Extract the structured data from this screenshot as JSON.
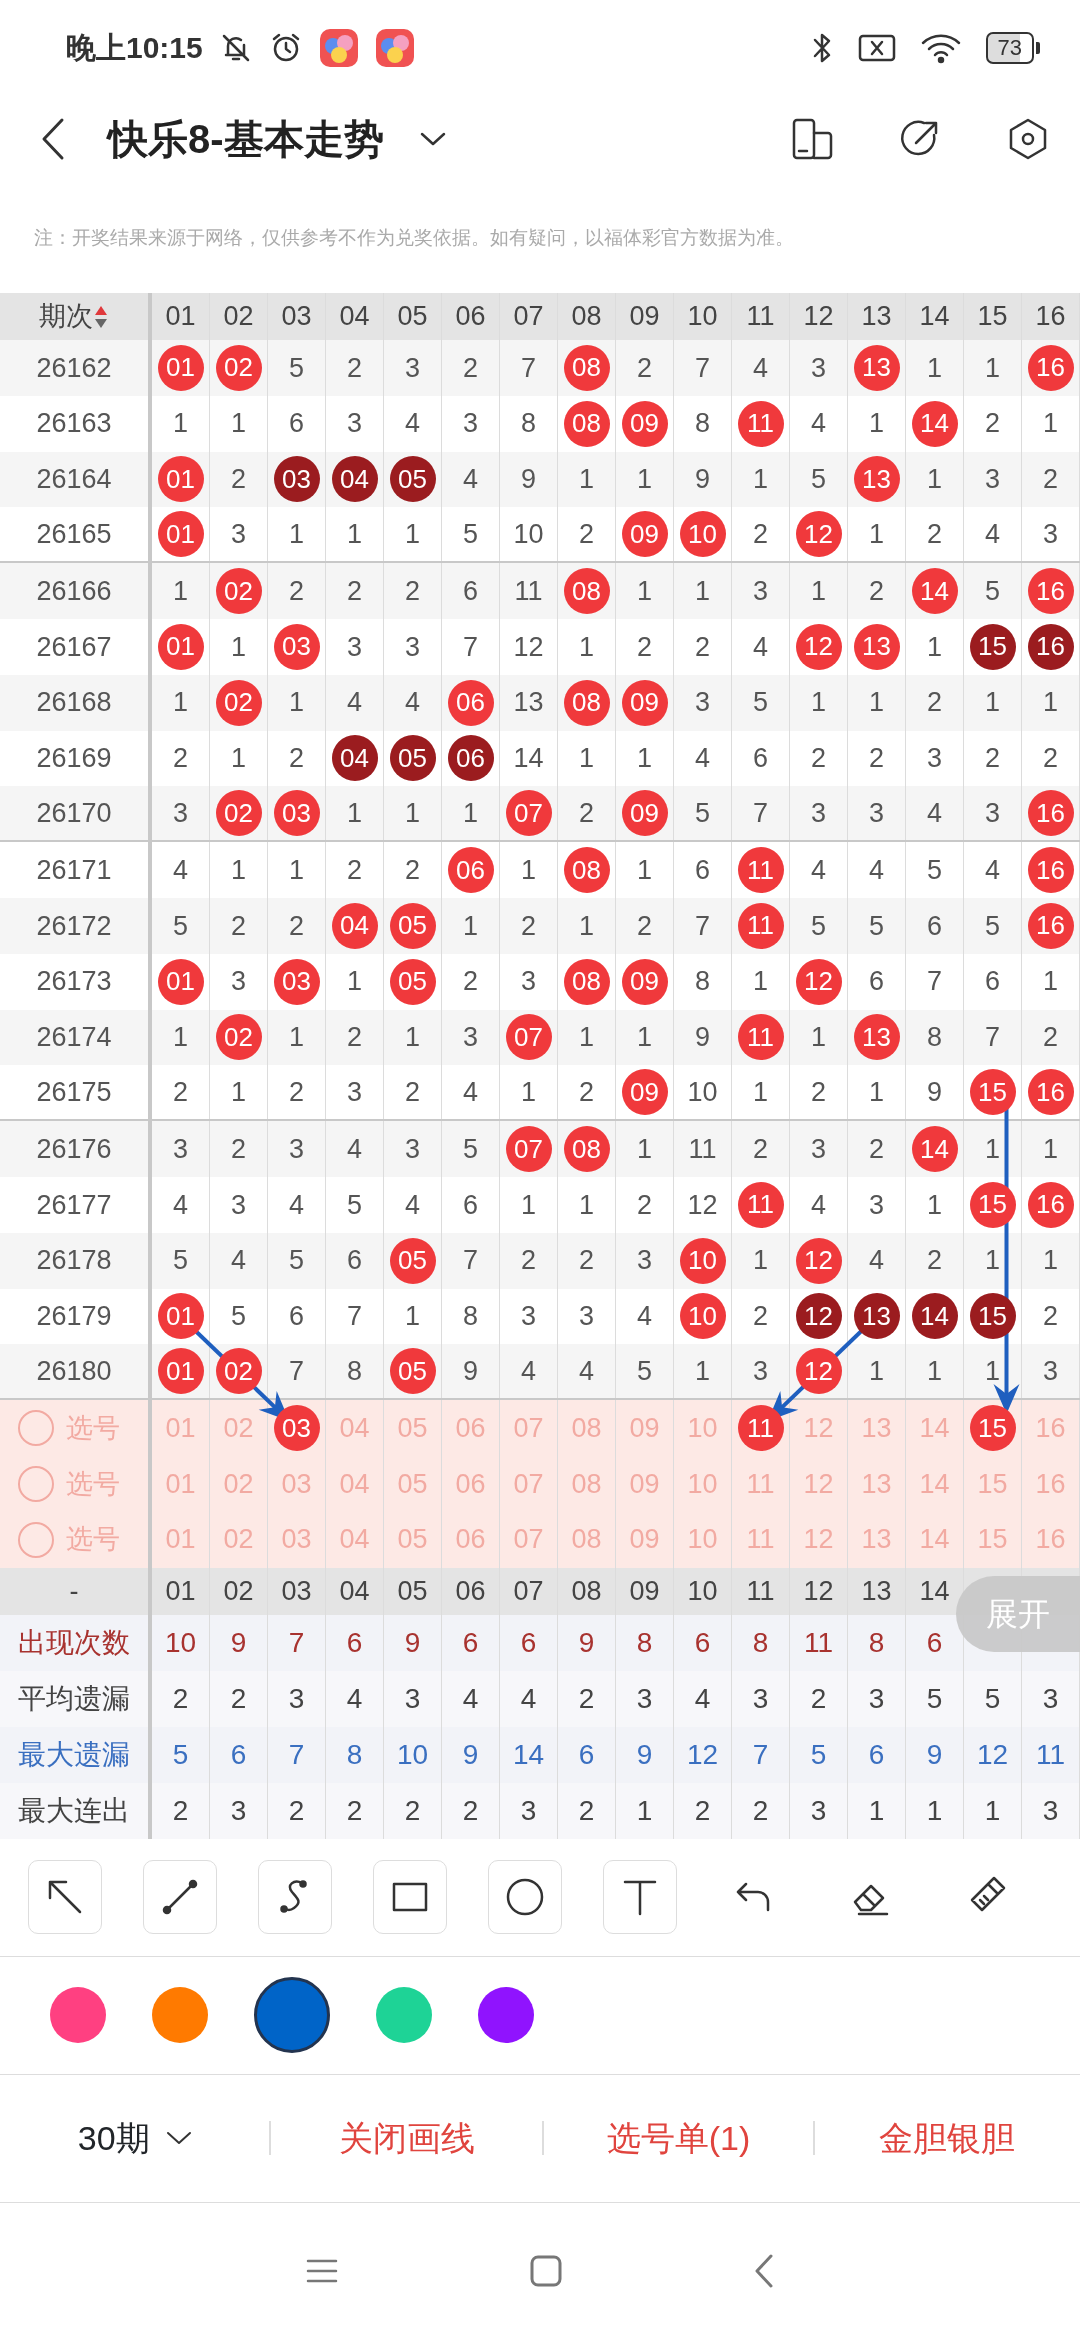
{
  "status_bar": {
    "time": "晚上10:15",
    "battery": "73"
  },
  "header": {
    "title": "快乐8-基本走势"
  },
  "notice": "注：开奖结果来源于网络，仅供参考不作为兑奖依据。如有疑问，以福体彩官方数据为准。",
  "table": {
    "period_label": "期次",
    "columns": [
      "01",
      "02",
      "03",
      "04",
      "05",
      "06",
      "07",
      "08",
      "09",
      "10",
      "11",
      "12",
      "13",
      "14",
      "15",
      "16"
    ],
    "rows": [
      {
        "period": "26162",
        "cells": [
          {
            "text": "01",
            "kind": "hit"
          },
          {
            "text": "02",
            "kind": "hit"
          },
          {
            "text": "5",
            "kind": "miss"
          },
          {
            "text": "2",
            "kind": "miss"
          },
          {
            "text": "3",
            "kind": "miss"
          },
          {
            "text": "2",
            "kind": "miss"
          },
          {
            "text": "7",
            "kind": "miss"
          },
          {
            "text": "08",
            "kind": "hit"
          },
          {
            "text": "2",
            "kind": "miss"
          },
          {
            "text": "7",
            "kind": "miss"
          },
          {
            "text": "4",
            "kind": "miss"
          },
          {
            "text": "3",
            "kind": "miss"
          },
          {
            "text": "13",
            "kind": "hit"
          },
          {
            "text": "1",
            "kind": "miss"
          },
          {
            "text": "1",
            "kind": "miss"
          },
          {
            "text": "16",
            "kind": "hit"
          }
        ]
      },
      {
        "period": "26163",
        "cells": [
          {
            "text": "1",
            "kind": "miss"
          },
          {
            "text": "1",
            "kind": "miss"
          },
          {
            "text": "6",
            "kind": "miss"
          },
          {
            "text": "3",
            "kind": "miss"
          },
          {
            "text": "4",
            "kind": "miss"
          },
          {
            "text": "3",
            "kind": "miss"
          },
          {
            "text": "8",
            "kind": "miss"
          },
          {
            "text": "08",
            "kind": "hit"
          },
          {
            "text": "09",
            "kind": "hit"
          },
          {
            "text": "8",
            "kind": "miss"
          },
          {
            "text": "11",
            "kind": "hit"
          },
          {
            "text": "4",
            "kind": "miss"
          },
          {
            "text": "1",
            "kind": "miss"
          },
          {
            "text": "14",
            "kind": "hit"
          },
          {
            "text": "2",
            "kind": "miss"
          },
          {
            "text": "1",
            "kind": "miss"
          }
        ]
      },
      {
        "period": "26164",
        "cells": [
          {
            "text": "01",
            "kind": "hit"
          },
          {
            "text": "2",
            "kind": "miss"
          },
          {
            "text": "03",
            "kind": "run"
          },
          {
            "text": "04",
            "kind": "run"
          },
          {
            "text": "05",
            "kind": "run"
          },
          {
            "text": "4",
            "kind": "miss"
          },
          {
            "text": "9",
            "kind": "miss"
          },
          {
            "text": "1",
            "kind": "miss"
          },
          {
            "text": "1",
            "kind": "miss"
          },
          {
            "text": "9",
            "kind": "miss"
          },
          {
            "text": "1",
            "kind": "miss"
          },
          {
            "text": "5",
            "kind": "miss"
          },
          {
            "text": "13",
            "kind": "hit"
          },
          {
            "text": "1",
            "kind": "miss"
          },
          {
            "text": "3",
            "kind": "miss"
          },
          {
            "text": "2",
            "kind": "miss"
          }
        ]
      },
      {
        "period": "26165",
        "cells": [
          {
            "text": "01",
            "kind": "hit"
          },
          {
            "text": "3",
            "kind": "miss"
          },
          {
            "text": "1",
            "kind": "miss"
          },
          {
            "text": "1",
            "kind": "miss"
          },
          {
            "text": "1",
            "kind": "miss"
          },
          {
            "text": "5",
            "kind": "miss"
          },
          {
            "text": "10",
            "kind": "miss"
          },
          {
            "text": "2",
            "kind": "miss"
          },
          {
            "text": "09",
            "kind": "hit"
          },
          {
            "text": "10",
            "kind": "hit"
          },
          {
            "text": "2",
            "kind": "miss"
          },
          {
            "text": "12",
            "kind": "hit"
          },
          {
            "text": "1",
            "kind": "miss"
          },
          {
            "text": "2",
            "kind": "miss"
          },
          {
            "text": "4",
            "kind": "miss"
          },
          {
            "text": "3",
            "kind": "miss"
          }
        ]
      },
      {
        "period": "26166",
        "cells": [
          {
            "text": "1",
            "kind": "miss"
          },
          {
            "text": "02",
            "kind": "hit"
          },
          {
            "text": "2",
            "kind": "miss"
          },
          {
            "text": "2",
            "kind": "miss"
          },
          {
            "text": "2",
            "kind": "miss"
          },
          {
            "text": "6",
            "kind": "miss"
          },
          {
            "text": "11",
            "kind": "miss"
          },
          {
            "text": "08",
            "kind": "hit"
          },
          {
            "text": "1",
            "kind": "miss"
          },
          {
            "text": "1",
            "kind": "miss"
          },
          {
            "text": "3",
            "kind": "miss"
          },
          {
            "text": "1",
            "kind": "miss"
          },
          {
            "text": "2",
            "kind": "miss"
          },
          {
            "text": "14",
            "kind": "hit"
          },
          {
            "text": "5",
            "kind": "miss"
          },
          {
            "text": "16",
            "kind": "hit"
          }
        ]
      },
      {
        "period": "26167",
        "cells": [
          {
            "text": "01",
            "kind": "hit"
          },
          {
            "text": "1",
            "kind": "miss"
          },
          {
            "text": "03",
            "kind": "hit"
          },
          {
            "text": "3",
            "kind": "miss"
          },
          {
            "text": "3",
            "kind": "miss"
          },
          {
            "text": "7",
            "kind": "miss"
          },
          {
            "text": "12",
            "kind": "miss"
          },
          {
            "text": "1",
            "kind": "miss"
          },
          {
            "text": "2",
            "kind": "miss"
          },
          {
            "text": "2",
            "kind": "miss"
          },
          {
            "text": "4",
            "kind": "miss"
          },
          {
            "text": "12",
            "kind": "hit"
          },
          {
            "text": "13",
            "kind": "hit"
          },
          {
            "text": "1",
            "kind": "miss"
          },
          {
            "text": "15",
            "kind": "run"
          },
          {
            "text": "16",
            "kind": "run"
          }
        ]
      },
      {
        "period": "26168",
        "cells": [
          {
            "text": "1",
            "kind": "miss"
          },
          {
            "text": "02",
            "kind": "hit"
          },
          {
            "text": "1",
            "kind": "miss"
          },
          {
            "text": "4",
            "kind": "miss"
          },
          {
            "text": "4",
            "kind": "miss"
          },
          {
            "text": "06",
            "kind": "hit"
          },
          {
            "text": "13",
            "kind": "miss"
          },
          {
            "text": "08",
            "kind": "hit"
          },
          {
            "text": "09",
            "kind": "hit"
          },
          {
            "text": "3",
            "kind": "miss"
          },
          {
            "text": "5",
            "kind": "miss"
          },
          {
            "text": "1",
            "kind": "miss"
          },
          {
            "text": "1",
            "kind": "miss"
          },
          {
            "text": "2",
            "kind": "miss"
          },
          {
            "text": "1",
            "kind": "miss"
          },
          {
            "text": "1",
            "kind": "miss"
          }
        ]
      },
      {
        "period": "26169",
        "cells": [
          {
            "text": "2",
            "kind": "miss"
          },
          {
            "text": "1",
            "kind": "miss"
          },
          {
            "text": "2",
            "kind": "miss"
          },
          {
            "text": "04",
            "kind": "run"
          },
          {
            "text": "05",
            "kind": "run"
          },
          {
            "text": "06",
            "kind": "run"
          },
          {
            "text": "14",
            "kind": "miss"
          },
          {
            "text": "1",
            "kind": "miss"
          },
          {
            "text": "1",
            "kind": "miss"
          },
          {
            "text": "4",
            "kind": "miss"
          },
          {
            "text": "6",
            "kind": "miss"
          },
          {
            "text": "2",
            "kind": "miss"
          },
          {
            "text": "2",
            "kind": "miss"
          },
          {
            "text": "3",
            "kind": "miss"
          },
          {
            "text": "2",
            "kind": "miss"
          },
          {
            "text": "2",
            "kind": "miss"
          }
        ]
      },
      {
        "period": "26170",
        "cells": [
          {
            "text": "3",
            "kind": "miss"
          },
          {
            "text": "02",
            "kind": "hit"
          },
          {
            "text": "03",
            "kind": "hit"
          },
          {
            "text": "1",
            "kind": "miss"
          },
          {
            "text": "1",
            "kind": "miss"
          },
          {
            "text": "1",
            "kind": "miss"
          },
          {
            "text": "07",
            "kind": "hit"
          },
          {
            "text": "2",
            "kind": "miss"
          },
          {
            "text": "09",
            "kind": "hit"
          },
          {
            "text": "5",
            "kind": "miss"
          },
          {
            "text": "7",
            "kind": "miss"
          },
          {
            "text": "3",
            "kind": "miss"
          },
          {
            "text": "3",
            "kind": "miss"
          },
          {
            "text": "4",
            "kind": "miss"
          },
          {
            "text": "3",
            "kind": "miss"
          },
          {
            "text": "16",
            "kind": "hit"
          }
        ]
      },
      {
        "period": "26171",
        "cells": [
          {
            "text": "4",
            "kind": "miss"
          },
          {
            "text": "1",
            "kind": "miss"
          },
          {
            "text": "1",
            "kind": "miss"
          },
          {
            "text": "2",
            "kind": "miss"
          },
          {
            "text": "2",
            "kind": "miss"
          },
          {
            "text": "06",
            "kind": "hit"
          },
          {
            "text": "1",
            "kind": "miss"
          },
          {
            "text": "08",
            "kind": "hit"
          },
          {
            "text": "1",
            "kind": "miss"
          },
          {
            "text": "6",
            "kind": "miss"
          },
          {
            "text": "11",
            "kind": "hit"
          },
          {
            "text": "4",
            "kind": "miss"
          },
          {
            "text": "4",
            "kind": "miss"
          },
          {
            "text": "5",
            "kind": "miss"
          },
          {
            "text": "4",
            "kind": "miss"
          },
          {
            "text": "16",
            "kind": "hit"
          }
        ]
      },
      {
        "period": "26172",
        "cells": [
          {
            "text": "5",
            "kind": "miss"
          },
          {
            "text": "2",
            "kind": "miss"
          },
          {
            "text": "2",
            "kind": "miss"
          },
          {
            "text": "04",
            "kind": "hit"
          },
          {
            "text": "05",
            "kind": "hit"
          },
          {
            "text": "1",
            "kind": "miss"
          },
          {
            "text": "2",
            "kind": "miss"
          },
          {
            "text": "1",
            "kind": "miss"
          },
          {
            "text": "2",
            "kind": "miss"
          },
          {
            "text": "7",
            "kind": "miss"
          },
          {
            "text": "11",
            "kind": "hit"
          },
          {
            "text": "5",
            "kind": "miss"
          },
          {
            "text": "5",
            "kind": "miss"
          },
          {
            "text": "6",
            "kind": "miss"
          },
          {
            "text": "5",
            "kind": "miss"
          },
          {
            "text": "16",
            "kind": "hit"
          }
        ]
      },
      {
        "period": "26173",
        "cells": [
          {
            "text": "01",
            "kind": "hit"
          },
          {
            "text": "3",
            "kind": "miss"
          },
          {
            "text": "03",
            "kind": "hit"
          },
          {
            "text": "1",
            "kind": "miss"
          },
          {
            "text": "05",
            "kind": "hit"
          },
          {
            "text": "2",
            "kind": "miss"
          },
          {
            "text": "3",
            "kind": "miss"
          },
          {
            "text": "08",
            "kind": "hit"
          },
          {
            "text": "09",
            "kind": "hit"
          },
          {
            "text": "8",
            "kind": "miss"
          },
          {
            "text": "1",
            "kind": "miss"
          },
          {
            "text": "12",
            "kind": "hit"
          },
          {
            "text": "6",
            "kind": "miss"
          },
          {
            "text": "7",
            "kind": "miss"
          },
          {
            "text": "6",
            "kind": "miss"
          },
          {
            "text": "1",
            "kind": "miss"
          }
        ]
      },
      {
        "period": "26174",
        "cells": [
          {
            "text": "1",
            "kind": "miss"
          },
          {
            "text": "02",
            "kind": "hit"
          },
          {
            "text": "1",
            "kind": "miss"
          },
          {
            "text": "2",
            "kind": "miss"
          },
          {
            "text": "1",
            "kind": "miss"
          },
          {
            "text": "3",
            "kind": "miss"
          },
          {
            "text": "07",
            "kind": "hit"
          },
          {
            "text": "1",
            "kind": "miss"
          },
          {
            "text": "1",
            "kind": "miss"
          },
          {
            "text": "9",
            "kind": "miss"
          },
          {
            "text": "11",
            "kind": "hit"
          },
          {
            "text": "1",
            "kind": "miss"
          },
          {
            "text": "13",
            "kind": "hit"
          },
          {
            "text": "8",
            "kind": "miss"
          },
          {
            "text": "7",
            "kind": "miss"
          },
          {
            "text": "2",
            "kind": "miss"
          }
        ]
      },
      {
        "period": "26175",
        "cells": [
          {
            "text": "2",
            "kind": "miss"
          },
          {
            "text": "1",
            "kind": "miss"
          },
          {
            "text": "2",
            "kind": "miss"
          },
          {
            "text": "3",
            "kind": "miss"
          },
          {
            "text": "2",
            "kind": "miss"
          },
          {
            "text": "4",
            "kind": "miss"
          },
          {
            "text": "1",
            "kind": "miss"
          },
          {
            "text": "2",
            "kind": "miss"
          },
          {
            "text": "09",
            "kind": "hit"
          },
          {
            "text": "10",
            "kind": "miss"
          },
          {
            "text": "1",
            "kind": "miss"
          },
          {
            "text": "2",
            "kind": "miss"
          },
          {
            "text": "1",
            "kind": "miss"
          },
          {
            "text": "9",
            "kind": "miss"
          },
          {
            "text": "15",
            "kind": "hit"
          },
          {
            "text": "16",
            "kind": "hit"
          }
        ]
      },
      {
        "period": "26176",
        "cells": [
          {
            "text": "3",
            "kind": "miss"
          },
          {
            "text": "2",
            "kind": "miss"
          },
          {
            "text": "3",
            "kind": "miss"
          },
          {
            "text": "4",
            "kind": "miss"
          },
          {
            "text": "3",
            "kind": "miss"
          },
          {
            "text": "5",
            "kind": "miss"
          },
          {
            "text": "07",
            "kind": "hit"
          },
          {
            "text": "08",
            "kind": "hit"
          },
          {
            "text": "1",
            "kind": "miss"
          },
          {
            "text": "11",
            "kind": "miss"
          },
          {
            "text": "2",
            "kind": "miss"
          },
          {
            "text": "3",
            "kind": "miss"
          },
          {
            "text": "2",
            "kind": "miss"
          },
          {
            "text": "14",
            "kind": "hit"
          },
          {
            "text": "1",
            "kind": "miss"
          },
          {
            "text": "1",
            "kind": "miss"
          }
        ]
      },
      {
        "period": "26177",
        "cells": [
          {
            "text": "4",
            "kind": "miss"
          },
          {
            "text": "3",
            "kind": "miss"
          },
          {
            "text": "4",
            "kind": "miss"
          },
          {
            "text": "5",
            "kind": "miss"
          },
          {
            "text": "4",
            "kind": "miss"
          },
          {
            "text": "6",
            "kind": "miss"
          },
          {
            "text": "1",
            "kind": "miss"
          },
          {
            "text": "1",
            "kind": "miss"
          },
          {
            "text": "2",
            "kind": "miss"
          },
          {
            "text": "12",
            "kind": "miss"
          },
          {
            "text": "11",
            "kind": "hit"
          },
          {
            "text": "4",
            "kind": "miss"
          },
          {
            "text": "3",
            "kind": "miss"
          },
          {
            "text": "1",
            "kind": "miss"
          },
          {
            "text": "15",
            "kind": "hit"
          },
          {
            "text": "16",
            "kind": "hit"
          }
        ]
      },
      {
        "period": "26178",
        "cells": [
          {
            "text": "5",
            "kind": "miss"
          },
          {
            "text": "4",
            "kind": "miss"
          },
          {
            "text": "5",
            "kind": "miss"
          },
          {
            "text": "6",
            "kind": "miss"
          },
          {
            "text": "05",
            "kind": "hit"
          },
          {
            "text": "7",
            "kind": "miss"
          },
          {
            "text": "2",
            "kind": "miss"
          },
          {
            "text": "2",
            "kind": "miss"
          },
          {
            "text": "3",
            "kind": "miss"
          },
          {
            "text": "10",
            "kind": "hit"
          },
          {
            "text": "1",
            "kind": "miss"
          },
          {
            "text": "12",
            "kind": "hit"
          },
          {
            "text": "4",
            "kind": "miss"
          },
          {
            "text": "2",
            "kind": "miss"
          },
          {
            "text": "1",
            "kind": "miss"
          },
          {
            "text": "1",
            "kind": "miss"
          }
        ]
      },
      {
        "period": "26179",
        "cells": [
          {
            "text": "01",
            "kind": "hit"
          },
          {
            "text": "5",
            "kind": "miss"
          },
          {
            "text": "6",
            "kind": "miss"
          },
          {
            "text": "7",
            "kind": "miss"
          },
          {
            "text": "1",
            "kind": "miss"
          },
          {
            "text": "8",
            "kind": "miss"
          },
          {
            "text": "3",
            "kind": "miss"
          },
          {
            "text": "3",
            "kind": "miss"
          },
          {
            "text": "4",
            "kind": "miss"
          },
          {
            "text": "10",
            "kind": "hit"
          },
          {
            "text": "2",
            "kind": "miss"
          },
          {
            "text": "12",
            "kind": "run"
          },
          {
            "text": "13",
            "kind": "run"
          },
          {
            "text": "14",
            "kind": "run"
          },
          {
            "text": "15",
            "kind": "run"
          },
          {
            "text": "2",
            "kind": "miss"
          }
        ]
      },
      {
        "period": "26180",
        "cells": [
          {
            "text": "01",
            "kind": "hit"
          },
          {
            "text": "02",
            "kind": "hit"
          },
          {
            "text": "7",
            "kind": "miss"
          },
          {
            "text": "8",
            "kind": "miss"
          },
          {
            "text": "05",
            "kind": "hit"
          },
          {
            "text": "9",
            "kind": "miss"
          },
          {
            "text": "4",
            "kind": "miss"
          },
          {
            "text": "4",
            "kind": "miss"
          },
          {
            "text": "5",
            "kind": "miss"
          },
          {
            "text": "1",
            "kind": "miss"
          },
          {
            "text": "3",
            "kind": "miss"
          },
          {
            "text": "12",
            "kind": "hit"
          },
          {
            "text": "1",
            "kind": "miss"
          },
          {
            "text": "1",
            "kind": "miss"
          },
          {
            "text": "1",
            "kind": "miss"
          },
          {
            "text": "3",
            "kind": "miss"
          }
        ]
      }
    ]
  },
  "pick_rows": [
    {
      "label": "选号",
      "checked": false,
      "numbers": [
        {
          "text": "01",
          "selected": false
        },
        {
          "text": "02",
          "selected": false
        },
        {
          "text": "03",
          "selected": true
        },
        {
          "text": "04",
          "selected": false
        },
        {
          "text": "05",
          "selected": false
        },
        {
          "text": "06",
          "selected": false
        },
        {
          "text": "07",
          "selected": false
        },
        {
          "text": "08",
          "selected": false
        },
        {
          "text": "09",
          "selected": false
        },
        {
          "text": "10",
          "selected": false
        },
        {
          "text": "11",
          "selected": true
        },
        {
          "text": "12",
          "selected": false
        },
        {
          "text": "13",
          "selected": false
        },
        {
          "text": "14",
          "selected": false
        },
        {
          "text": "15",
          "selected": true
        },
        {
          "text": "16",
          "selected": false
        }
      ]
    },
    {
      "label": "选号",
      "checked": false,
      "numbers": [
        {
          "text": "01",
          "selected": false
        },
        {
          "text": "02",
          "selected": false
        },
        {
          "text": "03",
          "selected": false
        },
        {
          "text": "04",
          "selected": false
        },
        {
          "text": "05",
          "selected": false
        },
        {
          "text": "06",
          "selected": false
        },
        {
          "text": "07",
          "selected": false
        },
        {
          "text": "08",
          "selected": false
        },
        {
          "text": "09",
          "selected": false
        },
        {
          "text": "10",
          "selected": false
        },
        {
          "text": "11",
          "selected": false
        },
        {
          "text": "12",
          "selected": false
        },
        {
          "text": "13",
          "selected": false
        },
        {
          "text": "14",
          "selected": false
        },
        {
          "text": "15",
          "selected": false
        },
        {
          "text": "16",
          "selected": false
        }
      ]
    },
    {
      "label": "选号",
      "checked": false,
      "numbers": [
        {
          "text": "01",
          "selected": false
        },
        {
          "text": "02",
          "selected": false
        },
        {
          "text": "03",
          "selected": false
        },
        {
          "text": "04",
          "selected": false
        },
        {
          "text": "05",
          "selected": false
        },
        {
          "text": "06",
          "selected": false
        },
        {
          "text": "07",
          "selected": false
        },
        {
          "text": "08",
          "selected": false
        },
        {
          "text": "09",
          "selected": false
        },
        {
          "text": "10",
          "selected": false
        },
        {
          "text": "11",
          "selected": false
        },
        {
          "text": "12",
          "selected": false
        },
        {
          "text": "13",
          "selected": false
        },
        {
          "text": "14",
          "selected": false
        },
        {
          "text": "15",
          "selected": false
        },
        {
          "text": "16",
          "selected": false
        }
      ]
    }
  ],
  "stats": {
    "header_label": "-",
    "columns": [
      "01",
      "02",
      "03",
      "04",
      "05",
      "06",
      "07",
      "08",
      "09",
      "10",
      "11",
      "12",
      "13",
      "14"
    ],
    "rows": [
      {
        "label": "出现次数",
        "color": "#a8322f",
        "values": [
          "10",
          "9",
          "7",
          "6",
          "9",
          "6",
          "6",
          "9",
          "8",
          "6",
          "8",
          "11",
          "8",
          "6"
        ]
      },
      {
        "label": "平均遗漏",
        "color": "#444444",
        "values": [
          "2",
          "2",
          "3",
          "4",
          "3",
          "4",
          "4",
          "2",
          "3",
          "4",
          "3",
          "2",
          "3",
          "5",
          "5",
          "3"
        ]
      },
      {
        "label": "最大遗漏",
        "color": "#3a6fc0",
        "values": [
          "5",
          "6",
          "7",
          "8",
          "10",
          "9",
          "14",
          "6",
          "9",
          "12",
          "7",
          "5",
          "6",
          "9",
          "12",
          "11"
        ]
      },
      {
        "label": "最大连出",
        "color": "#444444",
        "values": [
          "2",
          "3",
          "2",
          "2",
          "2",
          "2",
          "3",
          "2",
          "1",
          "2",
          "2",
          "3",
          "1",
          "1",
          "1",
          "3"
        ]
      }
    ]
  },
  "expand_button": "展开",
  "palette": [
    {
      "color": "#ff4081",
      "selected": false
    },
    {
      "color": "#ff7a00",
      "selected": false
    },
    {
      "color": "#0064c8",
      "selected": true
    },
    {
      "color": "#1ed396",
      "selected": false
    },
    {
      "color": "#9013fe",
      "selected": false
    }
  ],
  "footer": {
    "period_select": "30期",
    "actions": [
      "关闭画线",
      "选号单(1)",
      "金胆银胆"
    ]
  }
}
